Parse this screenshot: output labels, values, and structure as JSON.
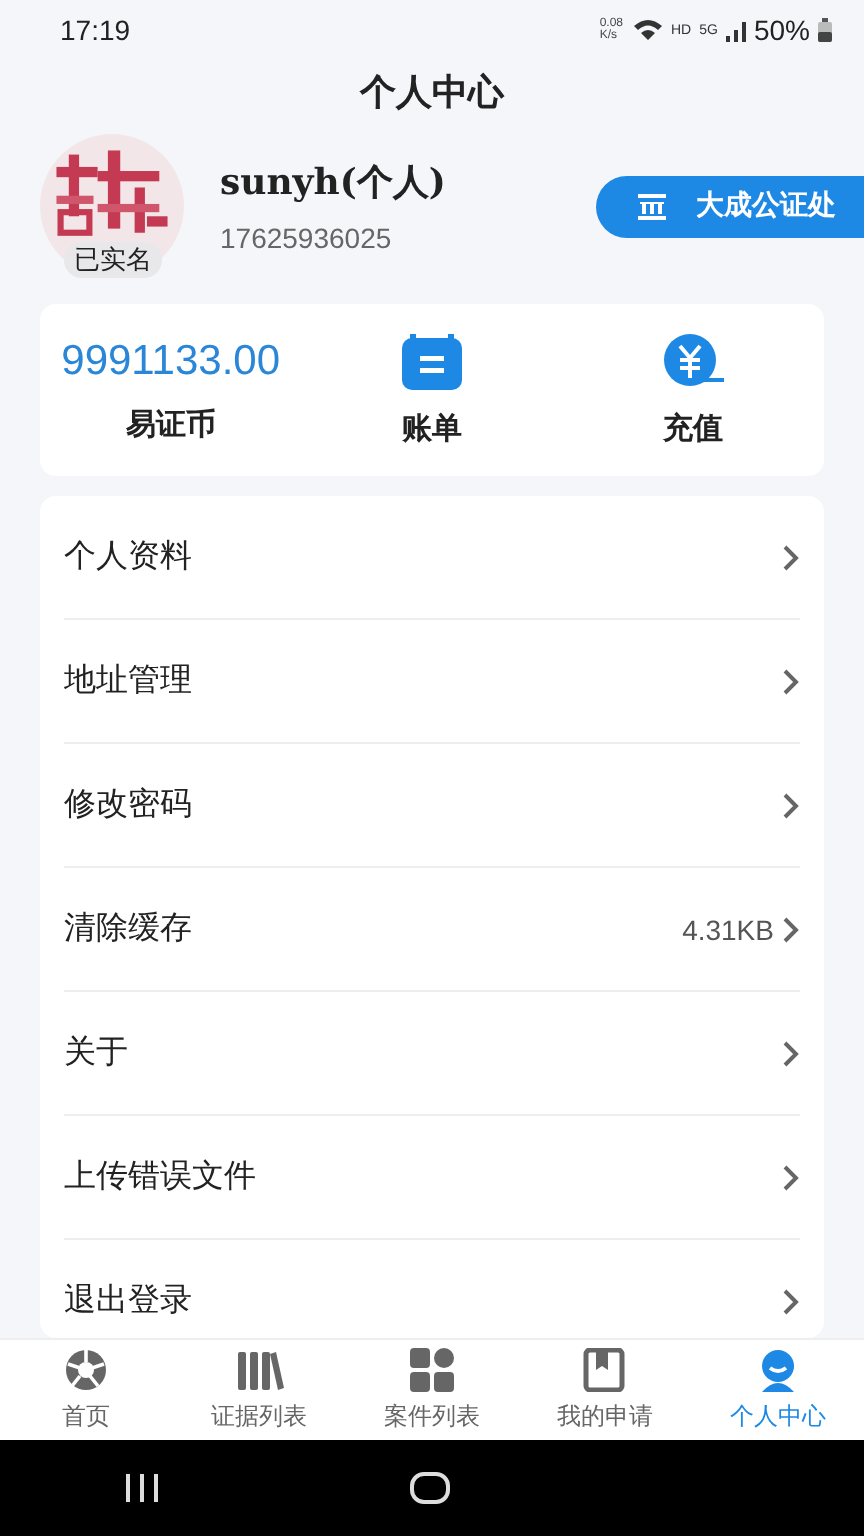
{
  "status_bar": {
    "time": "17:19",
    "net_speed": [
      "0.08",
      "K/s"
    ],
    "hd": "HD",
    "network": "5G",
    "battery": "50%"
  },
  "header": {
    "title": "个人中心"
  },
  "profile": {
    "name": "sunyh(个人)",
    "phone": "17625936025",
    "badge": "已实名",
    "office_button": "大成公证处"
  },
  "stats": [
    {
      "kind": "value",
      "value": "9991133.00",
      "label": "易证币"
    },
    {
      "kind": "bill",
      "label": "账单"
    },
    {
      "kind": "recharge",
      "label": "充值"
    }
  ],
  "menu": [
    {
      "label": "个人资料"
    },
    {
      "label": "地址管理"
    },
    {
      "label": "修改密码"
    },
    {
      "label": "清除缓存",
      "value": "4.31KB"
    },
    {
      "label": "关于"
    },
    {
      "label": "上传错误文件"
    },
    {
      "label": "退出登录"
    }
  ],
  "tabs": [
    {
      "kind": "home",
      "label": "首页",
      "selected": false
    },
    {
      "kind": "evidence",
      "label": "证据列表",
      "selected": false
    },
    {
      "kind": "cases",
      "label": "案件列表",
      "selected": false
    },
    {
      "kind": "apply",
      "label": "我的申请",
      "selected": false
    },
    {
      "kind": "profile",
      "label": "个人中心",
      "selected": true
    }
  ]
}
